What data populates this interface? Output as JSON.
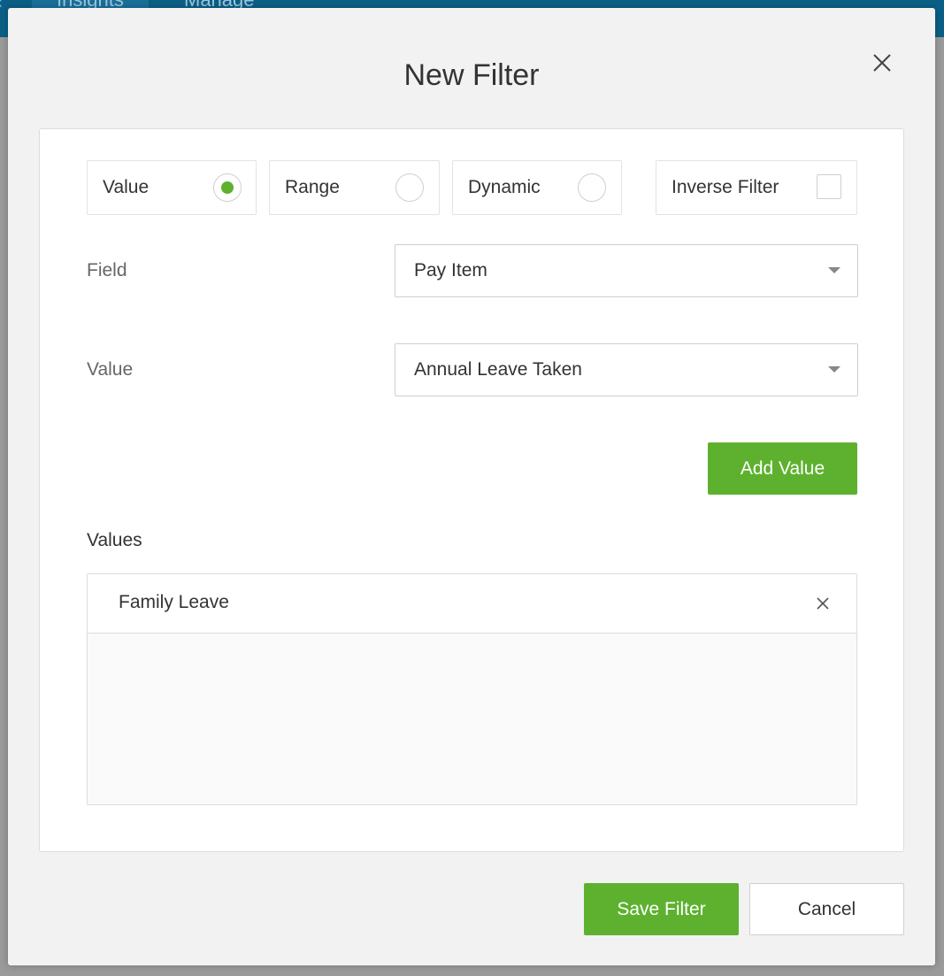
{
  "background": {
    "tabs": [
      "Insights",
      "Manage"
    ]
  },
  "modal": {
    "title": "New Filter",
    "filter_types": [
      {
        "label": "Value",
        "selected": true
      },
      {
        "label": "Range",
        "selected": false
      },
      {
        "label": "Dynamic",
        "selected": false
      }
    ],
    "inverse_filter": {
      "label": "Inverse Filter",
      "checked": false
    },
    "field": {
      "label": "Field",
      "selected": "Pay Item"
    },
    "value": {
      "label": "Value",
      "selected": "Annual Leave Taken"
    },
    "add_value_label": "Add Value",
    "values_heading": "Values",
    "values": [
      "Family Leave"
    ],
    "save_label": "Save Filter",
    "cancel_label": "Cancel"
  },
  "colors": {
    "accent_green": "#5db12f",
    "header_blue": "#0b5f86"
  },
  "icons": {
    "close": "close-icon",
    "caret": "chevron-down-icon",
    "remove": "remove-icon"
  }
}
